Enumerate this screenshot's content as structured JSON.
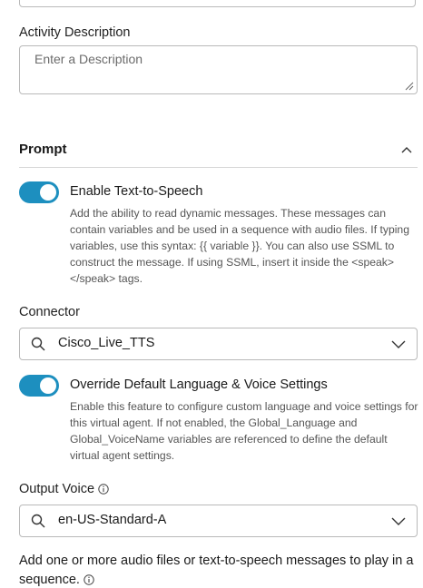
{
  "activity_description": {
    "label": "Activity Description",
    "placeholder": "Enter a Description"
  },
  "prompt_section": {
    "title": "Prompt"
  },
  "tts_toggle": {
    "label": "Enable Text-to-Speech",
    "enabled": true,
    "help": "Add the ability to read dynamic messages. These messages can contain variables and be used in a sequence with audio files. If typing variables, use this syntax: {{ variable }}. You can also use SSML to construct the message. If using SSML, insert it inside the <speak></speak> tags."
  },
  "connector": {
    "label": "Connector",
    "value": "Cisco_Live_TTS"
  },
  "override_toggle": {
    "label": "Override Default Language & Voice Settings",
    "enabled": true,
    "help": "Enable this feature to configure custom language and voice settings for this virtual agent. If not enabled, the Global_Language and Global_VoiceName variables are referenced to define the default virtual agent settings."
  },
  "output_voice": {
    "label": "Output Voice",
    "value": "en-US-Standard-A"
  },
  "sequence_hint": {
    "text": "Add one or more audio files or text-to-speech messages to play in a sequence."
  },
  "colors": {
    "toggle_on": "#1d8fbf",
    "border": "#b9b9b9"
  }
}
